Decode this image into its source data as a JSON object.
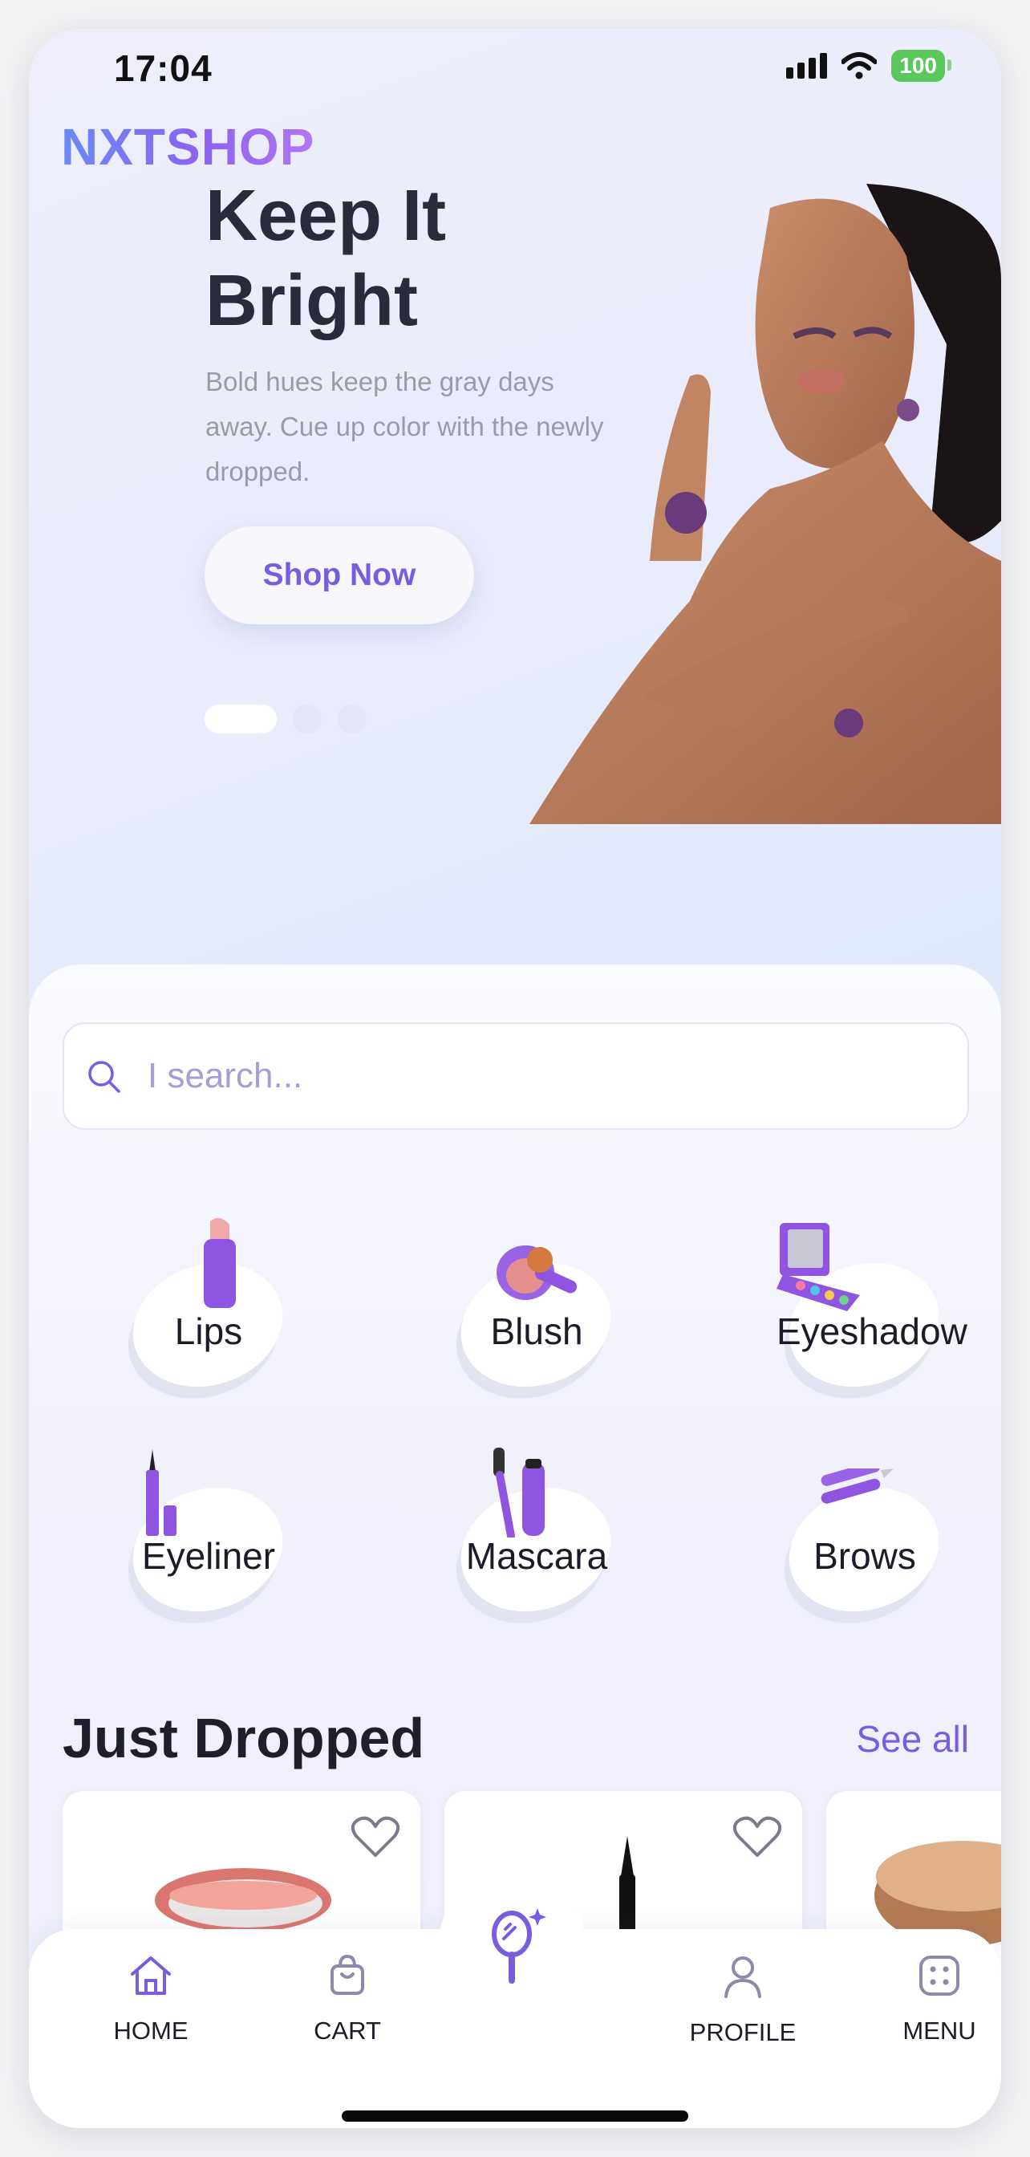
{
  "status_bar": {
    "time": "17:04",
    "battery": "100"
  },
  "app": {
    "logo": "NXTSHOP"
  },
  "hero": {
    "title": "Keep It Bright",
    "subtitle": "Bold hues keep the gray days away. Cue up color with the newly dropped.",
    "button_label": "Shop Now",
    "carousel_count": 3,
    "carousel_active": 1
  },
  "search": {
    "placeholder": "I search...",
    "value": ""
  },
  "categories": [
    {
      "label": "Lips",
      "icon": "lipstick-icon"
    },
    {
      "label": "Blush",
      "icon": "blush-compact-icon"
    },
    {
      "label": "Eyeshadow",
      "icon": "eyeshadow-palette-icon"
    },
    {
      "label": "Eyeliner",
      "icon": "eyeliner-icon"
    },
    {
      "label": "Mascara",
      "icon": "mascara-icon"
    },
    {
      "label": "Brows",
      "icon": "brow-pencil-icon"
    }
  ],
  "just_dropped": {
    "title": "Just Dropped",
    "see_all": "See all"
  },
  "nav": {
    "home": "HOME",
    "cart": "CART",
    "profile": "PROFILE",
    "menu": "MENU",
    "center_icon": "magic-mirror-icon"
  },
  "colors": {
    "accent": "#7a5ce0",
    "text": "#1e1e2e",
    "battery": "#5ac85a"
  }
}
